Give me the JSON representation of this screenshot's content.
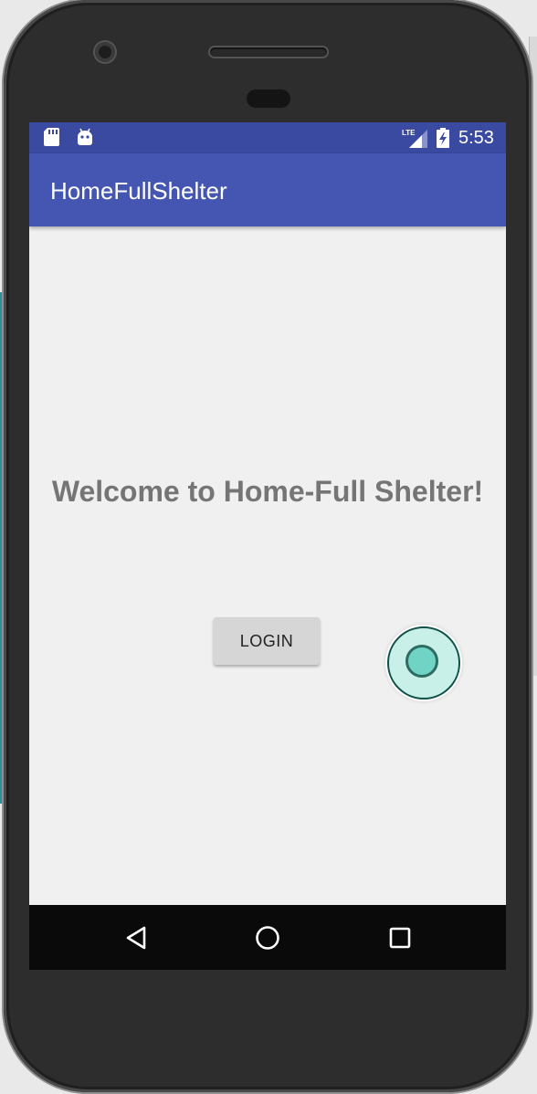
{
  "status_bar": {
    "time": "5:53",
    "icons": [
      "sd-card-icon",
      "android-icon",
      "lte-signal-icon",
      "battery-charging-icon"
    ]
  },
  "app_bar": {
    "title": "HomeFullShelter"
  },
  "main": {
    "welcome_text": "Welcome to Home-Full Shelter!",
    "login_label": "LOGIN"
  },
  "nav_bar": {
    "buttons": [
      "back-icon",
      "home-icon",
      "recents-icon"
    ]
  },
  "colors": {
    "status_bar": "#3a4aa0",
    "app_bar": "#4555b2",
    "background": "#f0f0f0",
    "welcome_text": "#757575",
    "button": "#d6d6d6"
  }
}
